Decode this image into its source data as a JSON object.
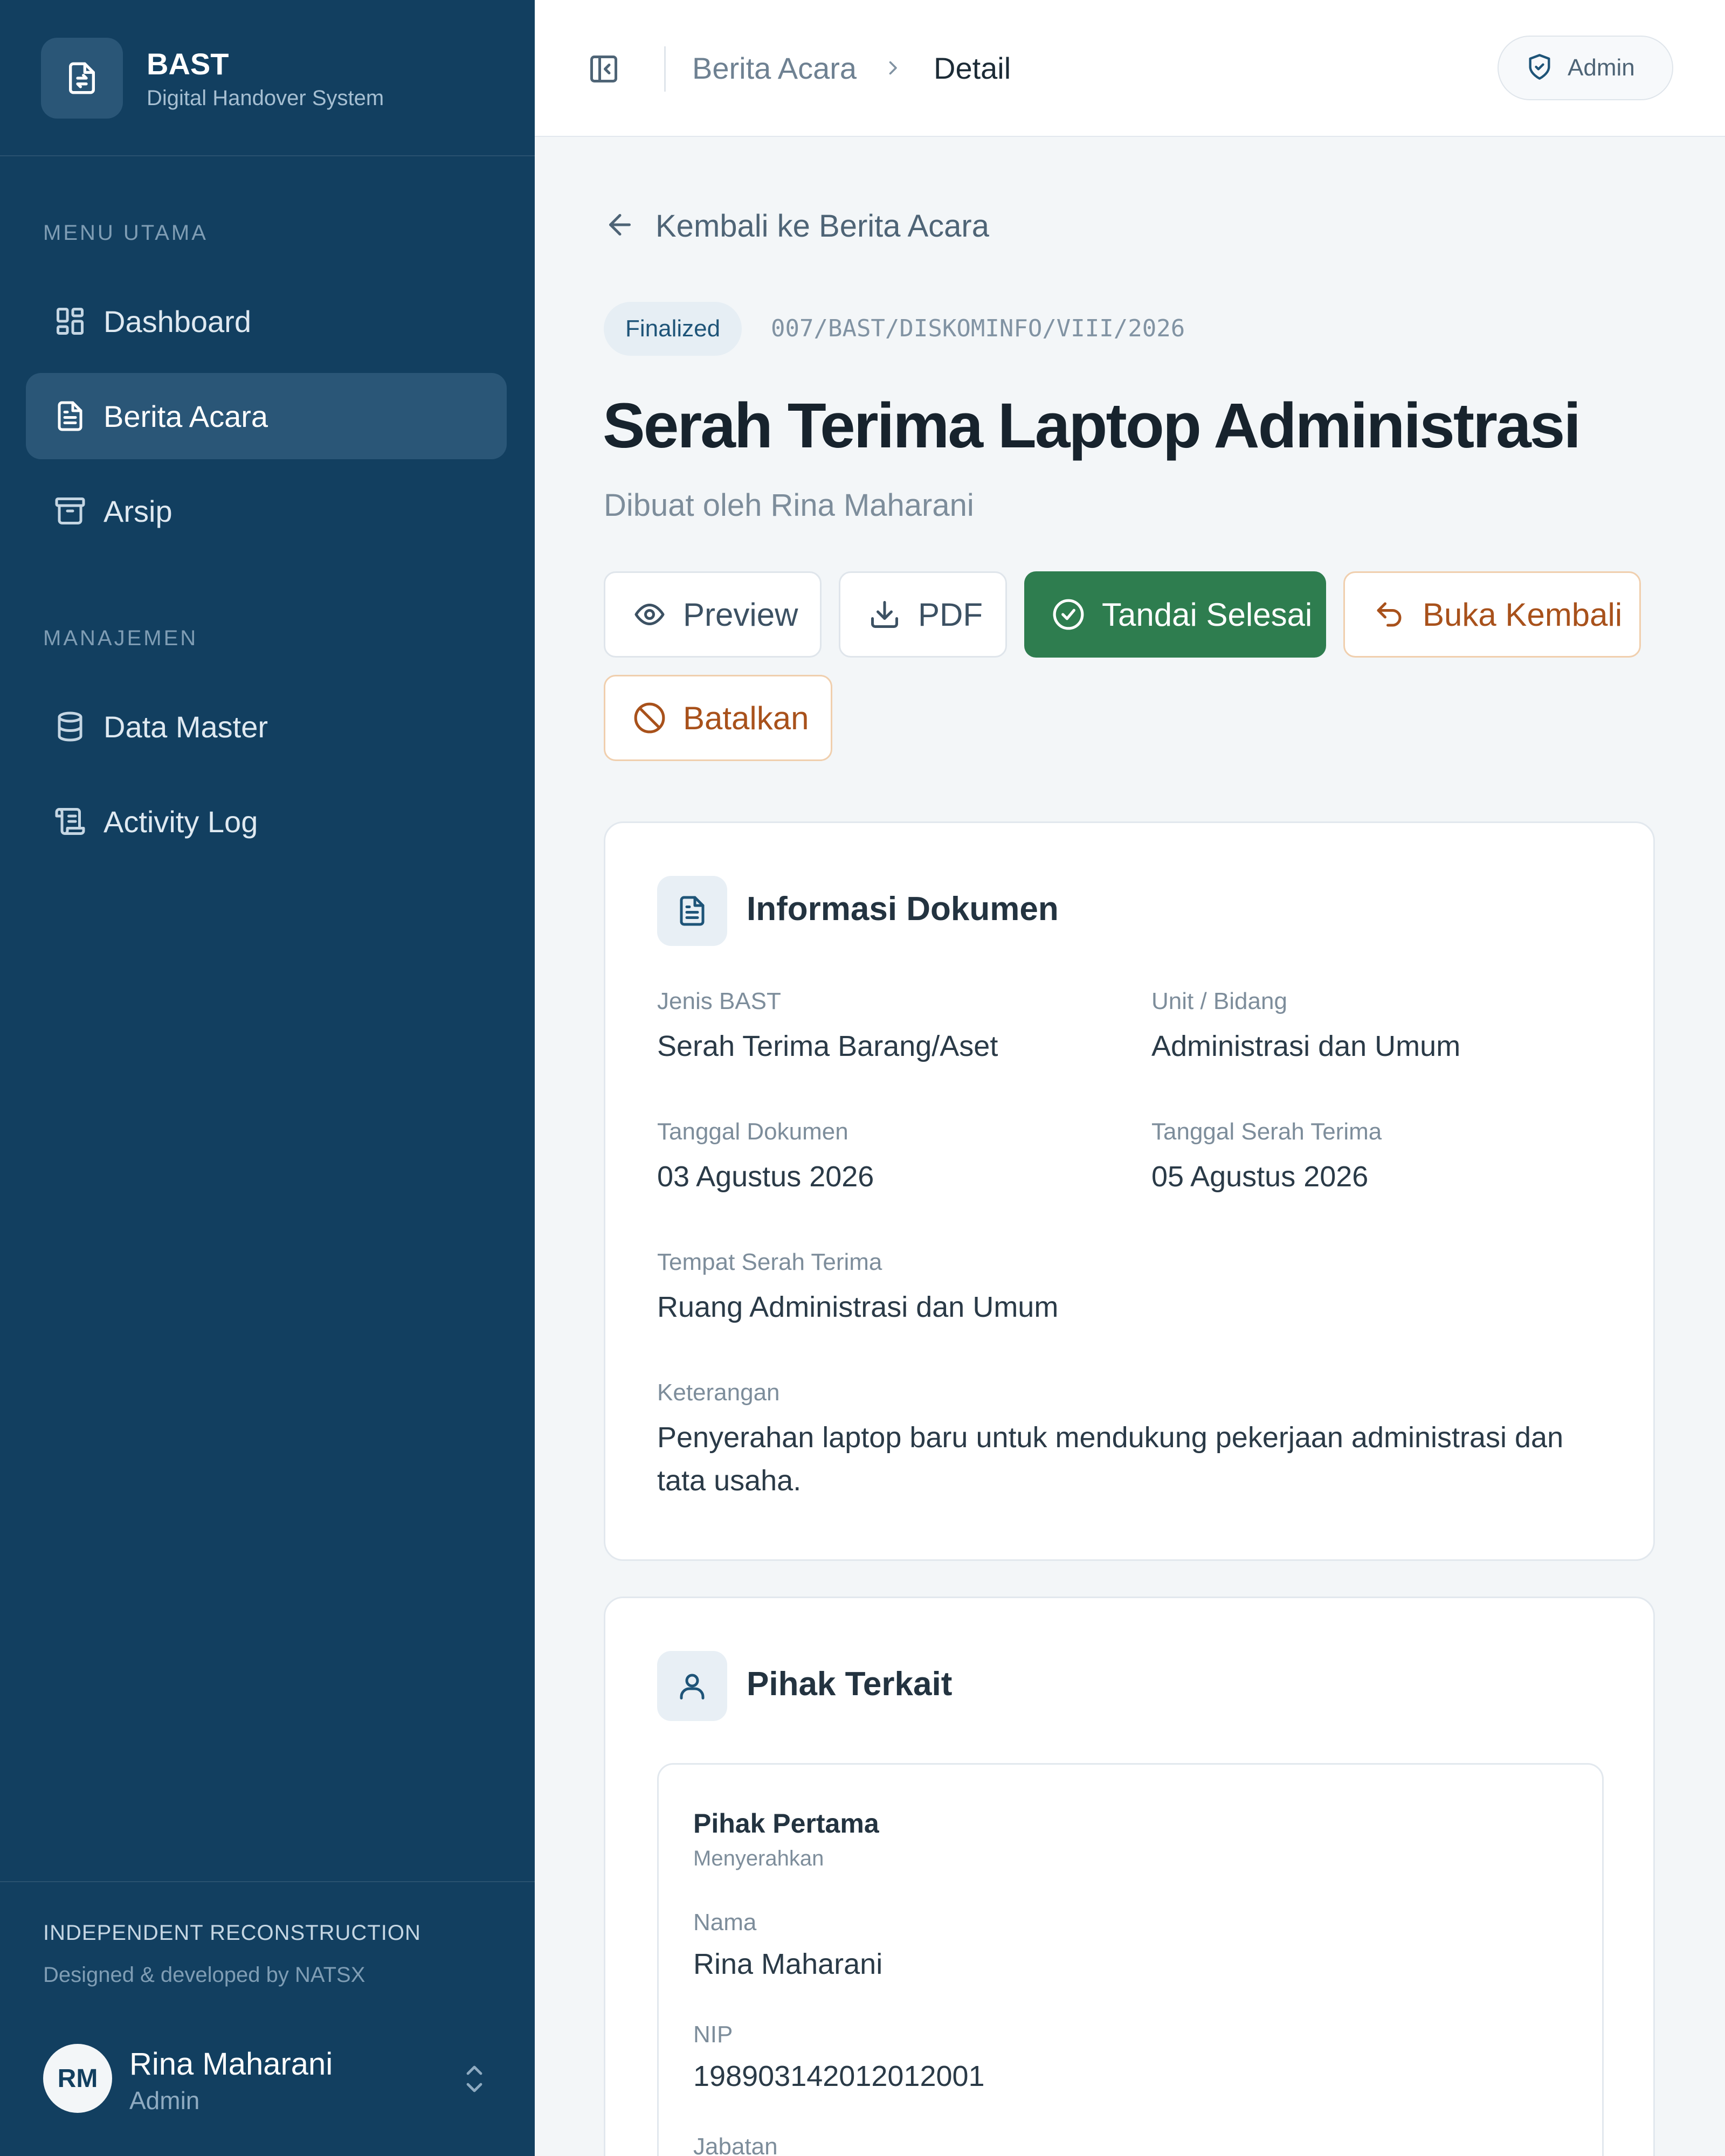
{
  "sidebar": {
    "brand": {
      "title": "BAST",
      "subtitle": "Digital Handover System"
    },
    "sections": [
      {
        "label": "MENU UTAMA"
      },
      {
        "label": "MANAJEMEN"
      }
    ],
    "items": [
      {
        "label": "Dashboard",
        "icon": "dashboard-icon"
      },
      {
        "label": "Berita Acara",
        "icon": "document-icon",
        "active": true
      },
      {
        "label": "Arsip",
        "icon": "archive-icon"
      },
      {
        "label": "Data Master",
        "icon": "database-icon"
      },
      {
        "label": "Activity Log",
        "icon": "scroll-icon"
      }
    ],
    "footer": {
      "title": "INDEPENDENT RECONSTRUCTION",
      "subtitle": "Designed & developed by NATSX"
    },
    "user": {
      "initials": "RM",
      "name": "Rina Maharani",
      "role": "Admin"
    }
  },
  "header": {
    "breadcrumb": [
      "Berita Acara",
      "Detail"
    ],
    "role_badge": "Admin"
  },
  "main": {
    "back_label": "Kembali ke Berita Acara",
    "status": "Finalized",
    "doc_number": "007/BAST/DISKOMINFO/VIII/2026",
    "title": "Serah Terima Laptop Administrasi",
    "subtitle": "Dibuat oleh Rina Maharani",
    "actions": {
      "preview": "Preview",
      "pdf": "PDF",
      "finish": "Tandai Selesai",
      "reopen": "Buka Kembali",
      "cancel": "Batalkan"
    },
    "info_card": {
      "title": "Informasi Dokumen",
      "fields": {
        "jenis": {
          "label": "Jenis BAST",
          "value": "Serah Terima Barang/Aset"
        },
        "unit": {
          "label": "Unit / Bidang",
          "value": "Administrasi dan Umum"
        },
        "tgl_dok": {
          "label": "Tanggal Dokumen",
          "value": "03 Agustus 2026"
        },
        "tgl_serah": {
          "label": "Tanggal Serah Terima",
          "value": "05 Agustus 2026"
        },
        "tempat": {
          "label": "Tempat Serah Terima",
          "value": "Ruang Administrasi dan Umum"
        },
        "keterangan": {
          "label": "Keterangan",
          "value": "Penyerahan laptop baru untuk mendukung pekerjaan administrasi dan tata usaha."
        }
      }
    },
    "parties_card": {
      "title": "Pihak Terkait",
      "first": {
        "title": "Pihak Pertama",
        "subtitle": "Menyerahkan",
        "fields": {
          "nama": {
            "label": "Nama",
            "value": "Rina Maharani"
          },
          "nip": {
            "label": "NIP",
            "value": "198903142012012001"
          },
          "jabatan": {
            "label": "Jabatan"
          }
        }
      }
    }
  },
  "colors": {
    "sidebar_bg": "#123f60",
    "sidebar_active": "#2a5677",
    "success": "#2e7d4f",
    "warning": "#a8511b",
    "page_bg": "#f3f6f8"
  }
}
